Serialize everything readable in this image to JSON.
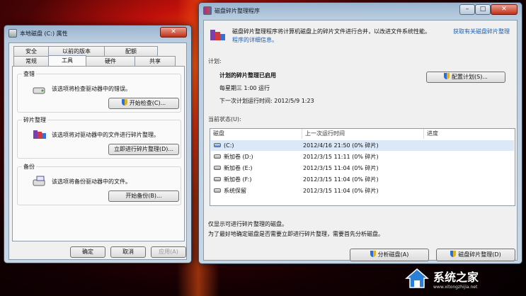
{
  "props": {
    "title": "本地磁盘 (C:) 属性",
    "tabs_top": [
      "安全",
      "以前的版本",
      "配额"
    ],
    "tabs_bottom": [
      "常规",
      "工具",
      "硬件",
      "共享"
    ],
    "groups": [
      {
        "title": "查错",
        "desc": "该选项将检查驱动器中的错误。",
        "button": "开始检查(C)..."
      },
      {
        "title": "碎片整理",
        "desc": "该选项将对驱动器中的文件进行碎片整理。",
        "button": "立即进行碎片整理(D)..."
      },
      {
        "title": "备份",
        "desc": "该选项将备份驱动器中的文件。",
        "button": "开始备份(B)..."
      }
    ],
    "ok": "确定",
    "cancel": "取消",
    "apply": "应用(A)"
  },
  "defrag": {
    "title": "磁盘碎片整理程序",
    "intro_line1": "磁盘碎片整理程序将计算机磁盘上的碎片文件进行合并，以改进文件系统性能。",
    "intro_link1": "获取有关磁盘碎片整理",
    "intro_link2": "程序的详细信息。",
    "schedule_label": "计划:",
    "schedule_status": "计划的碎片整理已启用",
    "schedule_when": "每星期三  1:00 运行",
    "schedule_next": "下一次计划运行时间: 2012/5/9 1:23",
    "config_button": "配置计划(S)...",
    "current_label": "当前状态(U):",
    "columns": [
      "磁盘",
      "上一次运行时间",
      "进度"
    ],
    "disks": [
      {
        "name": "(C:)",
        "last": "2012/4/16 21:50 (0% 碎片)"
      },
      {
        "name": "新加卷 (D:)",
        "last": "2012/3/15 11:11 (0% 碎片)"
      },
      {
        "name": "新加卷 (E:)",
        "last": "2012/3/15 11:04 (0% 碎片)"
      },
      {
        "name": "新加卷 (F:)",
        "last": "2012/3/15 11:04 (0% 碎片)"
      },
      {
        "name": "系统保留",
        "last": "2012/3/15 11:04 (0% 碎片)"
      }
    ],
    "note1": "仅显示可进行碎片整理的磁盘。",
    "note2": "为了最好地确定磁盘是否需要立即进行碎片整理，需要首先分析磁盘。",
    "analyze_button": "分析磁盘(A)",
    "defrag_button": "磁盘碎片整理(D)"
  },
  "watermark": {
    "text": "系统之家",
    "url": "www.xitongzhijia.net"
  }
}
